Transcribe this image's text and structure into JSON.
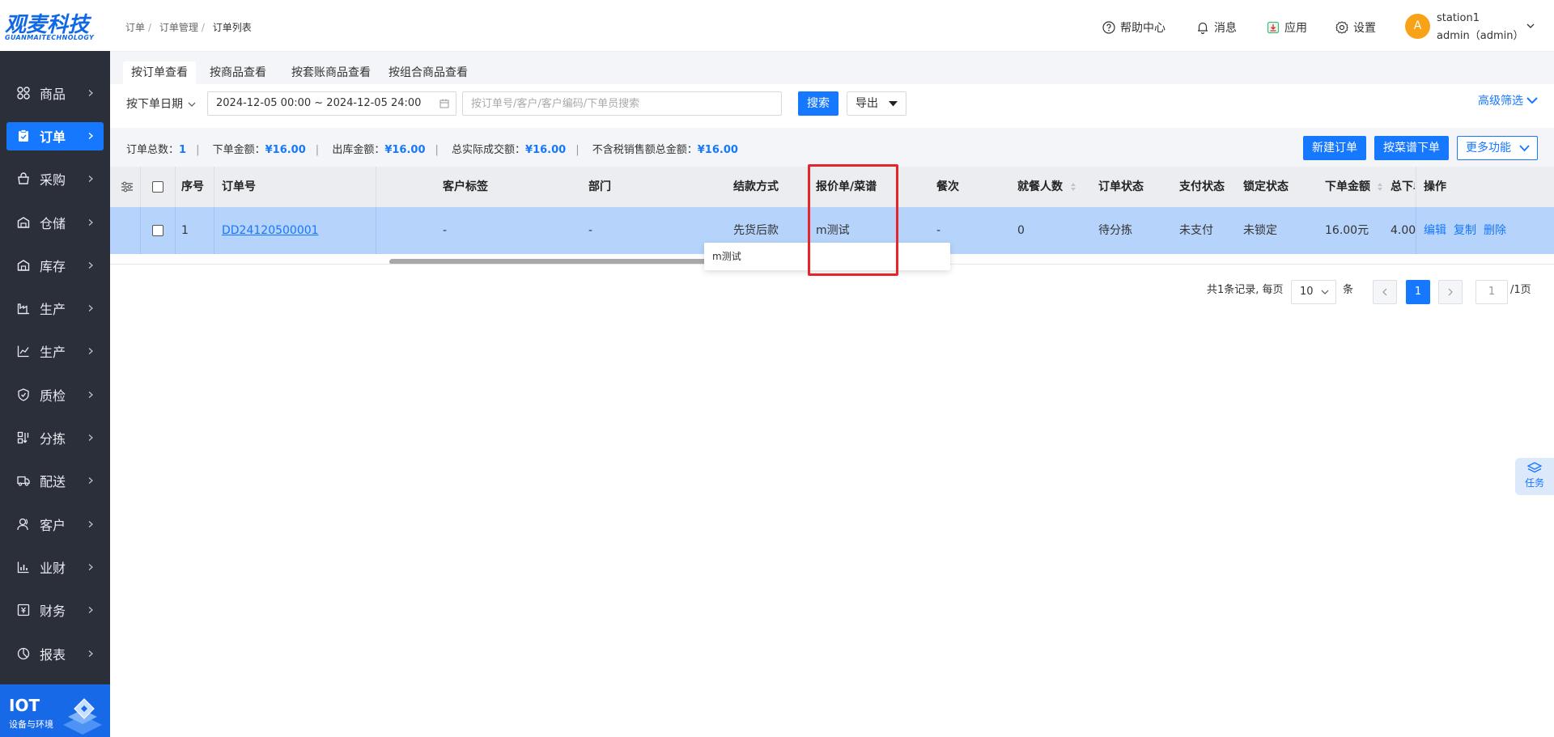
{
  "logo": {
    "main": "观麦科技",
    "sub": "GUANMAITECHNOLOGY"
  },
  "sidebar": {
    "items": [
      {
        "label": "商品",
        "icon": "grid-icon"
      },
      {
        "label": "订单",
        "icon": "order-icon",
        "active": true
      },
      {
        "label": "采购",
        "icon": "cart-icon"
      },
      {
        "label": "仓储",
        "icon": "warehouse-icon"
      },
      {
        "label": "库存",
        "icon": "inventory-icon"
      },
      {
        "label": "生产",
        "icon": "factory-icon"
      },
      {
        "label": "生产",
        "icon": "chart-icon"
      },
      {
        "label": "质检",
        "icon": "shield-icon"
      },
      {
        "label": "分拣",
        "icon": "sort-icon"
      },
      {
        "label": "配送",
        "icon": "truck-icon"
      },
      {
        "label": "客户",
        "icon": "user-icon"
      },
      {
        "label": "业财",
        "icon": "finance-chart-icon"
      },
      {
        "label": "财务",
        "icon": "money-icon"
      },
      {
        "label": "报表",
        "icon": "report-icon"
      }
    ],
    "iot": {
      "title": "IOT",
      "sub": "设备与环境"
    }
  },
  "header": {
    "breadcrumb": [
      "订单",
      "订单管理",
      "订单列表"
    ],
    "help": "帮助中心",
    "messages": "消息",
    "apps": "应用",
    "settings": "设置",
    "avatar_letter": "A",
    "user_station": "station1",
    "user_name": "admin（admin）"
  },
  "tabs": [
    "按订单查看",
    "按商品查看",
    "按套账商品查看",
    "按组合商品查看"
  ],
  "filters": {
    "date_type": "按下单日期",
    "date_range": "2024-12-05 00:00 ~ 2024-12-05 24:00",
    "search_placeholder": "按订单号/客户/客户编码/下单员搜索",
    "search_button": "搜索",
    "export_button": "导出",
    "advanced": "高级筛选"
  },
  "summary": {
    "order_count_label": "订单总数：",
    "order_count": "1",
    "order_amount_label": "下单金额：",
    "order_amount": "¥16.00",
    "outbound_amount_label": "出库金额：",
    "outbound_amount": "¥16.00",
    "actual_amount_label": "总实际成交额：",
    "actual_amount": "¥16.00",
    "pretax_amount_label": "不含税销售额总金额：",
    "pretax_amount": "¥16.00"
  },
  "actions": {
    "new_order": "新建订单",
    "menu_order": "按菜谱下单",
    "more": "更多功能"
  },
  "table": {
    "headers": {
      "seq": "序号",
      "order_no": "订单号",
      "customer_tag": "客户标签",
      "dept": "部门",
      "settlement": "结款方式",
      "quote": "报价单/菜谱",
      "meal": "餐次",
      "diners": "就餐人数",
      "order_status": "订单状态",
      "pay_status": "支付状态",
      "lock_status": "锁定状态",
      "amount": "下单金额",
      "total": "总下单",
      "ops": "操作"
    },
    "rows": [
      {
        "seq": "1",
        "order_no": "DD24120500001",
        "customer_tag": "-",
        "dept": "-",
        "settlement": "先货后款",
        "quote": "m测试",
        "meal": "-",
        "diners": "0",
        "order_status": "待分拣",
        "pay_status": "未支付",
        "lock_status": "未锁定",
        "amount": "16.00元",
        "total": "4.00",
        "ops": [
          "编辑",
          "复制",
          "删除"
        ]
      }
    ],
    "tooltip": "m测试"
  },
  "pagination": {
    "summary": "共1条记录, 每页",
    "page_size": "10",
    "unit": "条",
    "current": "1",
    "jump_value": "1",
    "total_pages": "/1页"
  },
  "float_task": "任务"
}
